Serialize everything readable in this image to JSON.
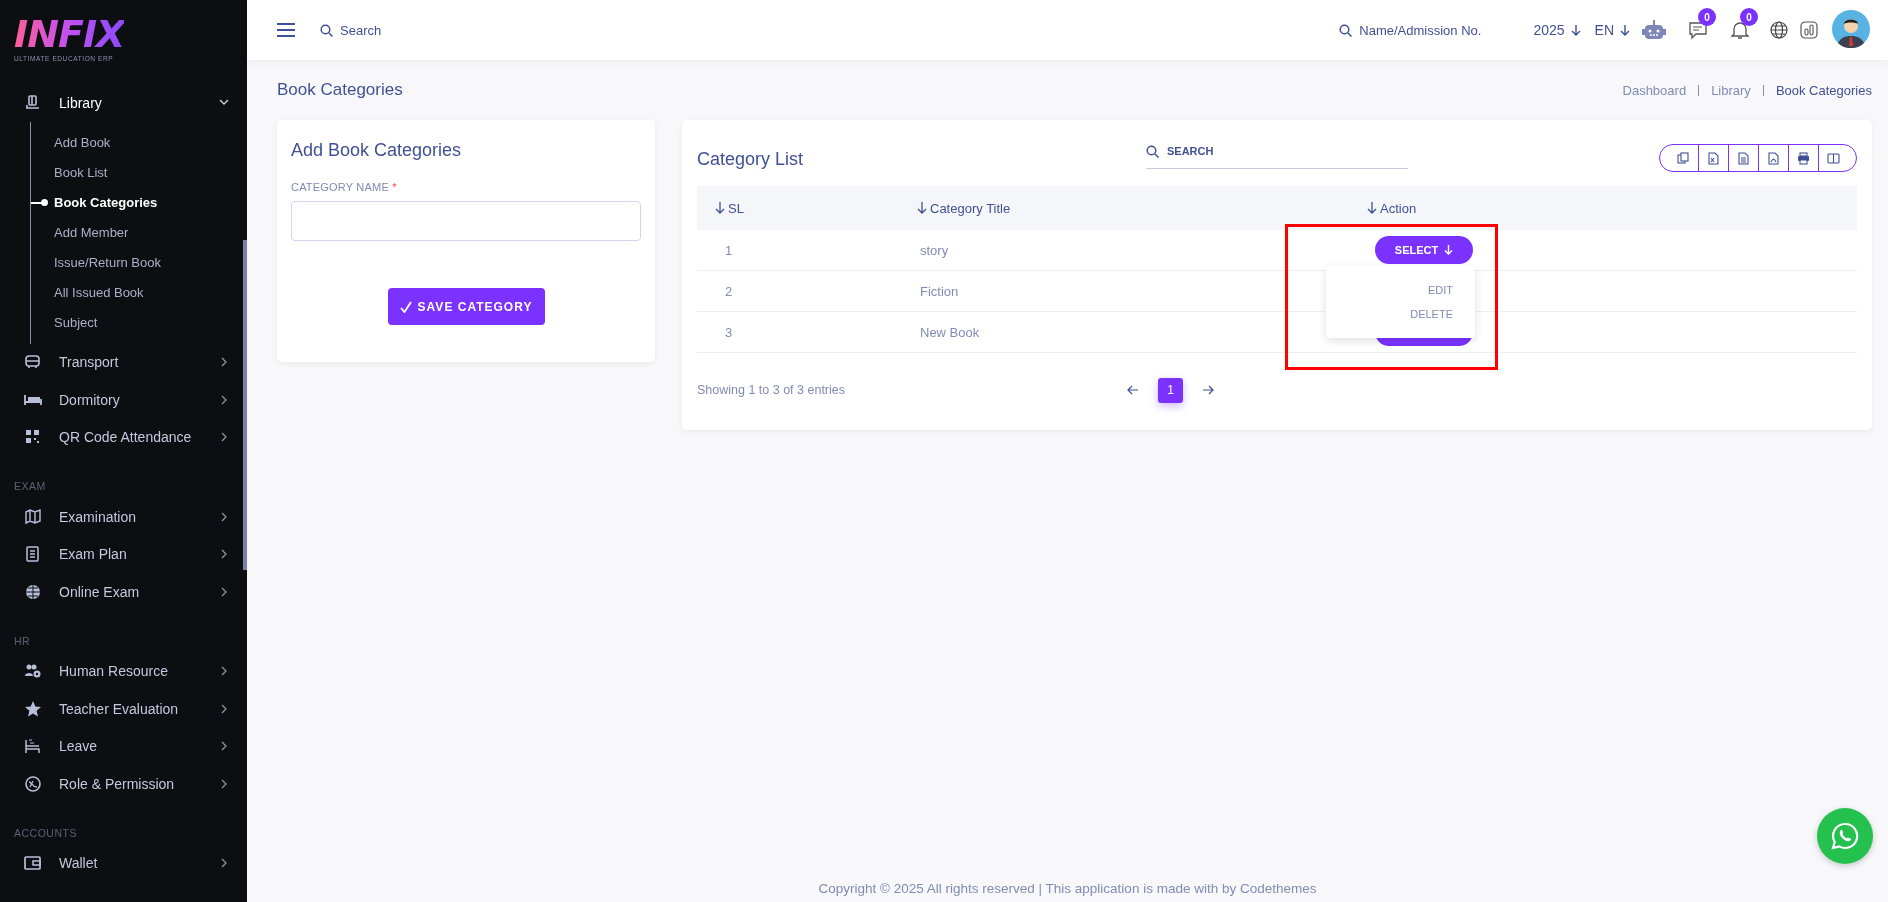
{
  "brand": {
    "logo": "INFIX",
    "tagline": "ULTIMATE EDUCATION ERP"
  },
  "sidebar": {
    "sections": [
      {
        "items": [
          {
            "label": "Library",
            "expanded": true,
            "children": [
              {
                "label": "Add Book",
                "selected": false
              },
              {
                "label": "Book List",
                "selected": false
              },
              {
                "label": "Book Categories",
                "selected": true
              },
              {
                "label": "Add Member",
                "selected": false
              },
              {
                "label": "Issue/Return Book",
                "selected": false
              },
              {
                "label": "All Issued Book",
                "selected": false
              },
              {
                "label": "Subject",
                "selected": false
              }
            ]
          },
          {
            "label": "Transport",
            "expanded": false
          },
          {
            "label": "Dormitory",
            "expanded": false
          },
          {
            "label": "QR Code Attendance",
            "expanded": false
          }
        ]
      },
      {
        "heading": "EXAM",
        "items": [
          {
            "label": "Examination",
            "expanded": false
          },
          {
            "label": "Exam Plan",
            "expanded": false
          },
          {
            "label": "Online Exam",
            "expanded": false
          }
        ]
      },
      {
        "heading": "HR",
        "items": [
          {
            "label": "Human Resource",
            "expanded": false
          },
          {
            "label": "Teacher Evaluation",
            "expanded": false
          },
          {
            "label": "Leave",
            "expanded": false
          },
          {
            "label": "Role & Permission",
            "expanded": false
          }
        ]
      },
      {
        "heading": "ACCOUNTS",
        "items": [
          {
            "label": "Wallet",
            "expanded": false
          }
        ]
      }
    ]
  },
  "topbar": {
    "search_placeholder": "Search",
    "student_search_placeholder": "Name/Admission No.",
    "year": "2025",
    "language": "EN",
    "chat_badge": "0",
    "notification_badge": "0"
  },
  "page": {
    "title": "Book Categories",
    "breadcrumb": [
      "Dashboard",
      "Library",
      "Book Categories"
    ]
  },
  "form": {
    "title": "Add Book Categories",
    "field_label": "CATEGORY NAME",
    "required_mark": "*",
    "save_button": "SAVE CATEGORY"
  },
  "table": {
    "title": "Category List",
    "search_placeholder": "SEARCH",
    "columns": [
      "SL",
      "Category Title",
      "Action"
    ],
    "rows": [
      {
        "sl": "1",
        "title": "story",
        "action_label": "SELECT"
      },
      {
        "sl": "2",
        "title": "Fiction"
      },
      {
        "sl": "3",
        "title": "New Book"
      }
    ],
    "action_menu": {
      "open": true,
      "highlighted": true,
      "items": [
        "EDIT",
        "DELETE"
      ]
    },
    "summary": "Showing 1 to 3 of 3 entries",
    "pages": [
      {
        "label": "1",
        "selected": true
      }
    ]
  },
  "footer": "Copyright © 2025 All rights reserved | This application is made with by Codethemes"
}
